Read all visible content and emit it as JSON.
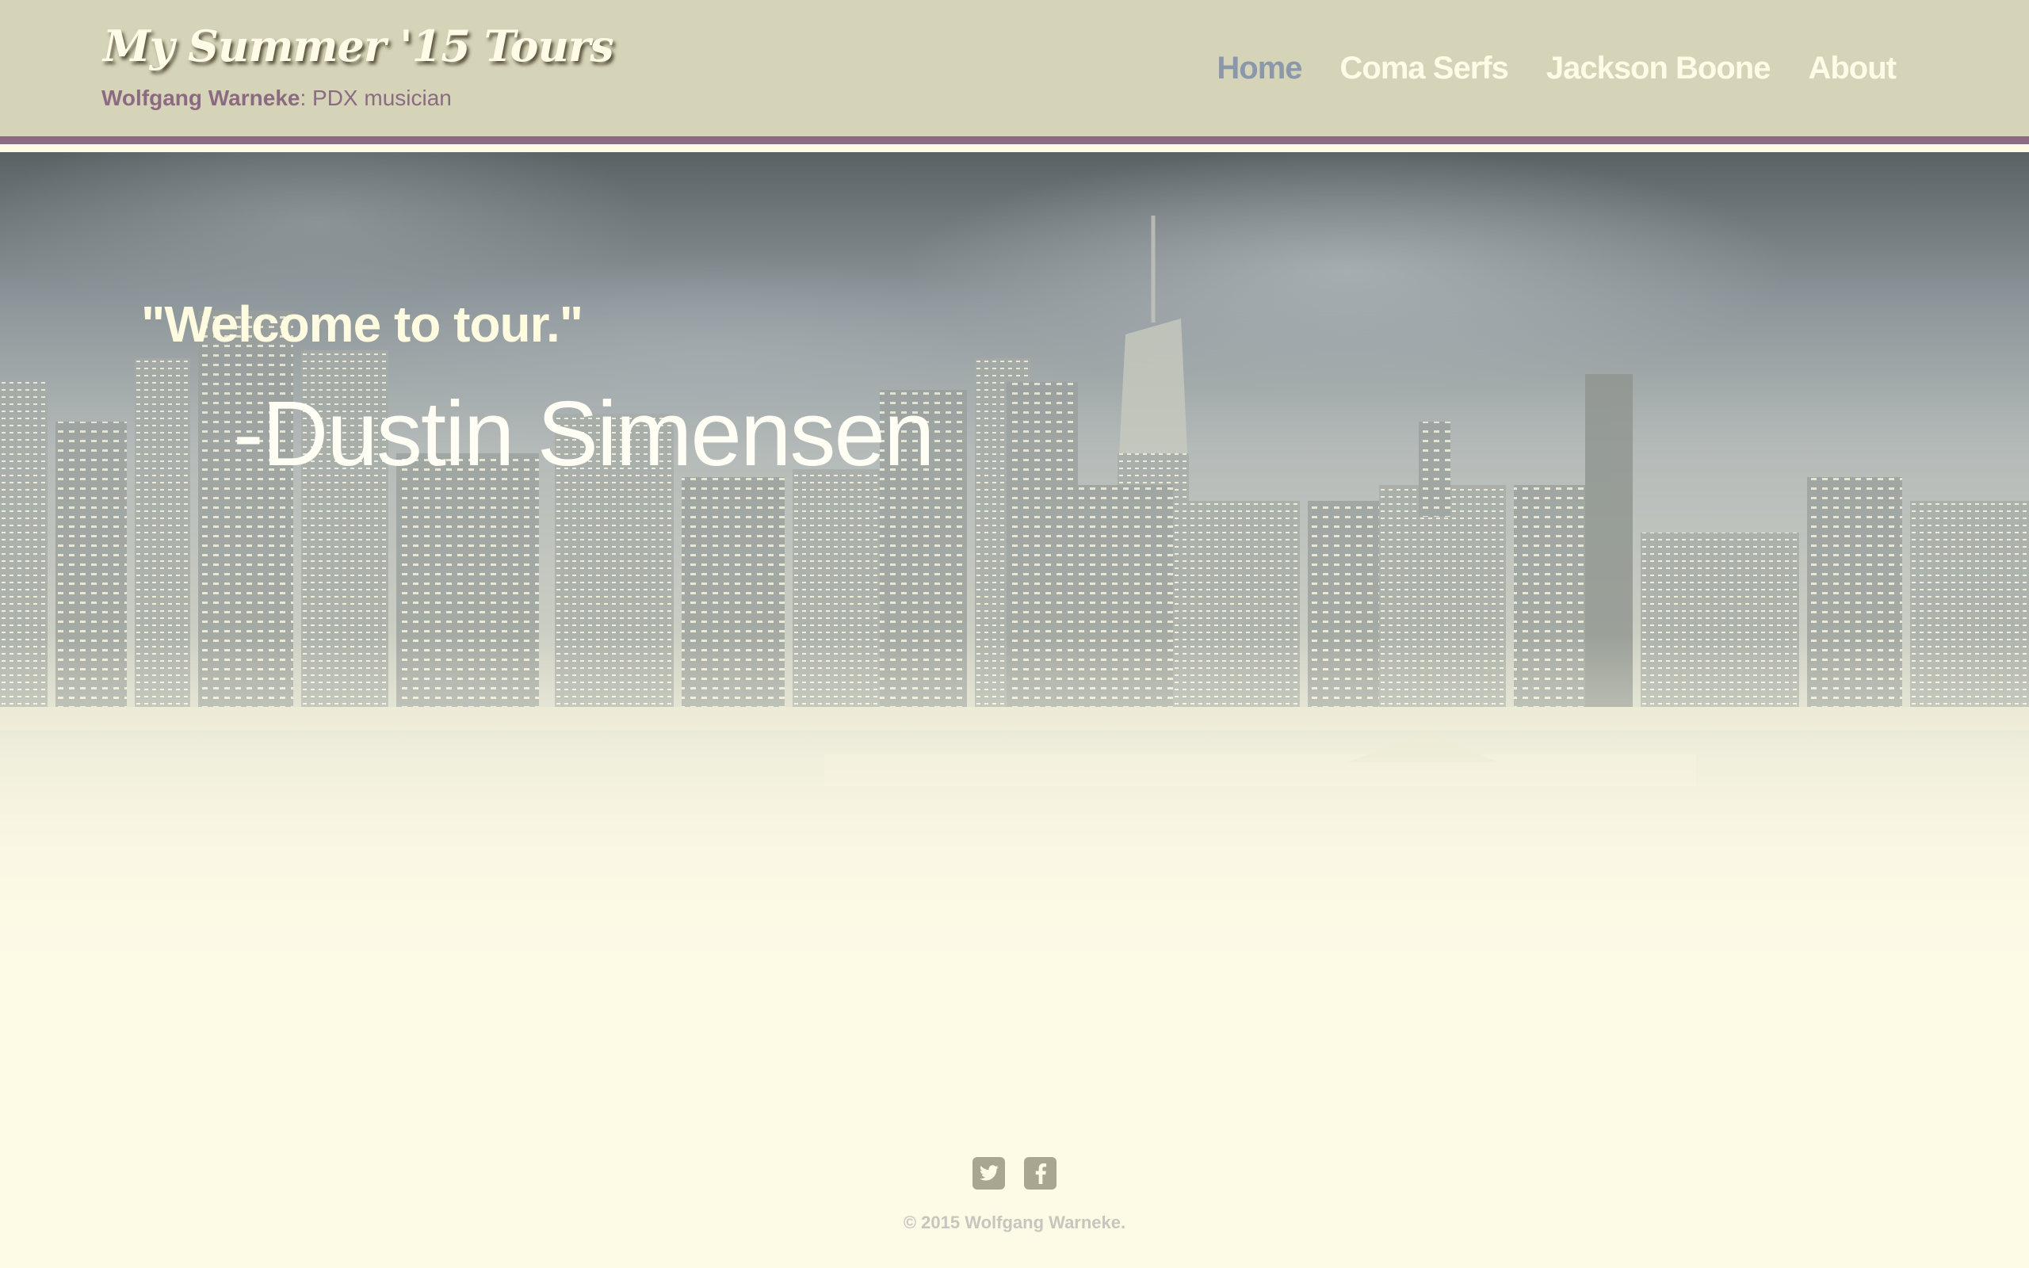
{
  "header": {
    "site_title": "My Summer '15 Tours",
    "tagline_name": "Wolfgang Warneke",
    "tagline_rest": ": PDX musician"
  },
  "nav": {
    "items": [
      {
        "label": "Home",
        "active": true
      },
      {
        "label": "Coma Serfs",
        "active": false
      },
      {
        "label": "Jackson Boone",
        "active": false
      },
      {
        "label": "About",
        "active": false
      }
    ]
  },
  "hero": {
    "quote": "\"Welcome to tour.\"",
    "author": "-Dustin Simensen"
  },
  "footer": {
    "social": [
      {
        "icon": "twitter-icon"
      },
      {
        "icon": "facebook-icon"
      }
    ],
    "copyright": "© 2015 Wolfgang Warneke."
  },
  "colors": {
    "header_bg": "#d5d4b8",
    "accent": "#8c6b82",
    "page_bg": "#fdfae6",
    "nav_active": "#8a98aa",
    "nav_text": "#fffbe6"
  }
}
